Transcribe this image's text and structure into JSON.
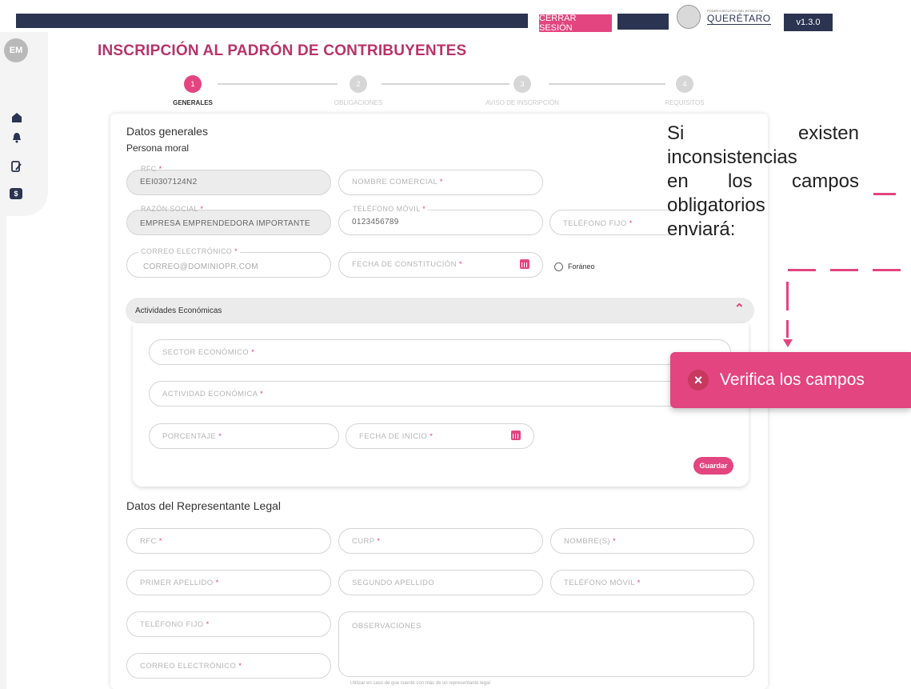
{
  "header": {
    "logout_label": "CERRAR SESIÓN",
    "logo_small": "PODER EJECUTIVO DEL ESTADO DE",
    "logo_name": "QUERÉTARO",
    "version": "v1.3.0"
  },
  "sidebar": {
    "avatar": "EM",
    "items": [
      {
        "icon": "home-icon"
      },
      {
        "icon": "bell-icon"
      },
      {
        "icon": "edit-document-icon"
      },
      {
        "icon": "money-icon",
        "label": "$"
      }
    ]
  },
  "page_title": "INSCRIPCIÓN AL PADRÓN DE CONTRIBUYENTES",
  "stepper": [
    {
      "number": "1",
      "label": "GENERALES",
      "active": true
    },
    {
      "number": "2",
      "label": "OBLIGACIONES",
      "active": false
    },
    {
      "number": "3",
      "label": "AVISO DE INSCRIPCIÓN",
      "active": false
    },
    {
      "number": "4",
      "label": "REQUISITOS",
      "active": false
    }
  ],
  "general": {
    "title": "Datos generales",
    "subtitle": "Persona moral",
    "rfc_label": "RFC",
    "rfc_value": "EEI0307124N2",
    "nombre_comercial_label": "NOMBRE COMERCIAL",
    "razon_social_label": "RAZÓN SOCIAL",
    "razon_social_value": "EMPRESA EMPRENDEDORA IMPORTANTE",
    "telefono_movil_label": "TELÉFONO MÓVIL",
    "telefono_movil_value": "0123456789",
    "telefono_fijo_label": "TELÉFONO FIJO",
    "correo_label": "CORREO ELECTRÓNICO",
    "correo_value": "CORREO@DOMINIOPR.COM",
    "fecha_constitucion_label": "FECHA DE CONSTITUCIÓN",
    "foraneo_label": "Foráneo"
  },
  "actividades": {
    "title": "Actividades Económicas",
    "sector_label": "SECTOR ECONÓMICO",
    "actividad_label": "ACTIVIDAD ECONÓMICA",
    "porcentaje_label": "PORCENTAJE",
    "fecha_inicio_label": "FECHA DE INICIO",
    "save_label": "Guardar"
  },
  "representante": {
    "title": "Datos del Representante Legal",
    "rfc_label": "RFC",
    "curp_label": "CURP",
    "nombre_label": "NOMBRE(S)",
    "primer_apellido_label": "PRIMER APELLIDO",
    "segundo_apellido_label": "SEGUNDO APELLIDO",
    "telefono_movil_label": "TELÉFONO MÓVIL",
    "telefono_fijo_label": "TELÉFONO FIJO",
    "observaciones_label": "OBSERVACIONES",
    "correo_label": "CORREO ELECTRÓNICO",
    "hint": "Utilizar en caso de que cuente con más de un representante legal"
  },
  "required_mark": "*",
  "annotation": {
    "lines": [
      "Si",
      "existen",
      "inconsistencias",
      "en",
      "los",
      "campos",
      "obligatorios",
      "enviará:"
    ]
  },
  "toast": {
    "icon": "close-icon",
    "text": "Verifica los campos"
  },
  "colors": {
    "accent": "#e2457f",
    "navy": "#2b3450",
    "title": "#b8336a"
  }
}
